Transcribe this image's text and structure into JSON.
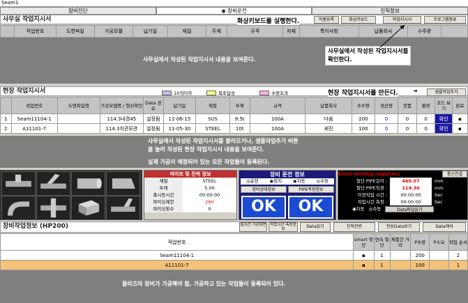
{
  "window": {
    "title": "Seam1"
  },
  "tabs": [
    "장비진단",
    "장비운전",
    "진척정보"
  ],
  "office": {
    "header": "사무실 작업지시서",
    "callout_run": "화상키보드를 실행한다.",
    "btn_register": "작품등록",
    "btn_keyboard": "화상키보드",
    "btn_order": "작업지시서",
    "btn_exit": "프로그램종료",
    "columns": [
      "작업번호",
      "도면파일",
      "가공모델",
      "납기일",
      "재질",
      "두께",
      "규격",
      "자재",
      "특이사항",
      "납품회사",
      "수주량"
    ],
    "desc": "사무실에서 작성된 작업지시서 내용을 보여준다.",
    "callout_check": "사무실에서 작성된 작업지시서를\n확인한다."
  },
  "field": {
    "header": "현장 작업지시서",
    "legend": [
      "10개이하",
      "목표달성",
      "수량초과"
    ],
    "callout_make": "현장 작업지시서를 만든다.",
    "btn_add": "샘플작업추가",
    "columns": [
      "",
      "작업번호",
      "도면파일명",
      "가공모델명 / 형상확인",
      "Data 경로",
      "납기일",
      "재질",
      "두께",
      "규격",
      "납품회사",
      "수주량",
      "생산량",
      "양품",
      "불량",
      "코드 보기",
      "완료"
    ],
    "rows": [
      {
        "no": "1",
        "job": "Seam11104-1",
        "file": "",
        "model": "114.3내경45",
        "path": "설정됨",
        "due": "11-06-15",
        "mat": "SUS",
        "thk": "9.5t",
        "spec": "100A",
        "company": "다움",
        "order": "200",
        "prod": "0",
        "good": "0",
        "bad": "0",
        "code": "확인"
      },
      {
        "no": "2",
        "job": "A11101-7",
        "file": "",
        "model": "114.3지관모관",
        "path": "설정됨",
        "due": "11-05-30",
        "mat": "STEEL",
        "thk": "10t",
        "spec": "100A",
        "company": "세진",
        "order": "100",
        "prod": "0",
        "good": "0",
        "bad": "0",
        "code": "확인"
      }
    ],
    "desc1": "사무실에서 작성된 작업지시서를 불러오거나, 샘플작업추가 버튼",
    "desc2": "을 눌러 작성된 현장 작업지시서 내용을 보여준다.",
    "desc3": "실제 가공이 예정되어 있는 모든 작업들이 등록된다."
  },
  "pipe": {
    "header": "파이프 및 진척 정보",
    "rows": [
      {
        "label": "재질",
        "value": "STEEL"
      },
      {
        "label": "두께",
        "value": "5.00"
      },
      {
        "label": "총시동시간",
        "value": "00:00:00"
      },
      {
        "label": "파이싱제한",
        "value": "260"
      },
      {
        "label": "파이싱횟수",
        "value": "0"
      }
    ]
  },
  "run": {
    "header": "장비 운전 정보",
    "opts": [
      "운전",
      "정지",
      "자동",
      "수동"
    ],
    "btn_state": "장비상태정보",
    "btn_pipe": "PIPE측정정보",
    "ok": "OK"
  },
  "status": {
    "error": "Error writing registers",
    "comm": "통신연결",
    "rows": [
      {
        "label": "절단 PIPE길이 :",
        "value": "460.57",
        "unit": "mm"
      },
      {
        "label": "절단 PIPE직경 :",
        "value": "114.30",
        "unit": "mm"
      },
      {
        "label": "이전작업 시간 :",
        "value": "00:00:00",
        "unit": "Sec"
      },
      {
        "label": "작업시간 측정 :",
        "value": "00:00:00",
        "unit": "Sec"
      }
    ],
    "auto": "자동",
    "manual": "수동",
    "data_btn": "Data파일읽기"
  },
  "equip": {
    "header": "장비작업정보 (HP200)",
    "btns": [
      "실시간 가공화면",
      "작업시간 측정정보",
      "Data읽기",
      "진척관련",
      "전송Data보기",
      "Data해석"
    ],
    "columns": [
      "작업번호",
      "smart 찾단",
      "연속 절단",
      "제품간 거리",
      "P수량",
      "P소요",
      "작업 순서"
    ],
    "rows": [
      {
        "job": "Seam11104-1",
        "cont": "1",
        "qty": "200",
        "seq": "2"
      },
      {
        "job": "A11101-7",
        "cont": "1",
        "qty": "100",
        "seq": "1"
      }
    ],
    "desc": "플라즈마 장비가 가공해야 할, 가공하고 있는 작업들이 등록되어 있다."
  },
  "colors": {
    "legend1": "#c8b8f0",
    "legend2": "#ffff80",
    "legend3": "#ffb0d8",
    "okblue": "#1a4bd2",
    "highlight": "#f5c27a",
    "red": "#e00000",
    "cyan": "#00ffff"
  }
}
